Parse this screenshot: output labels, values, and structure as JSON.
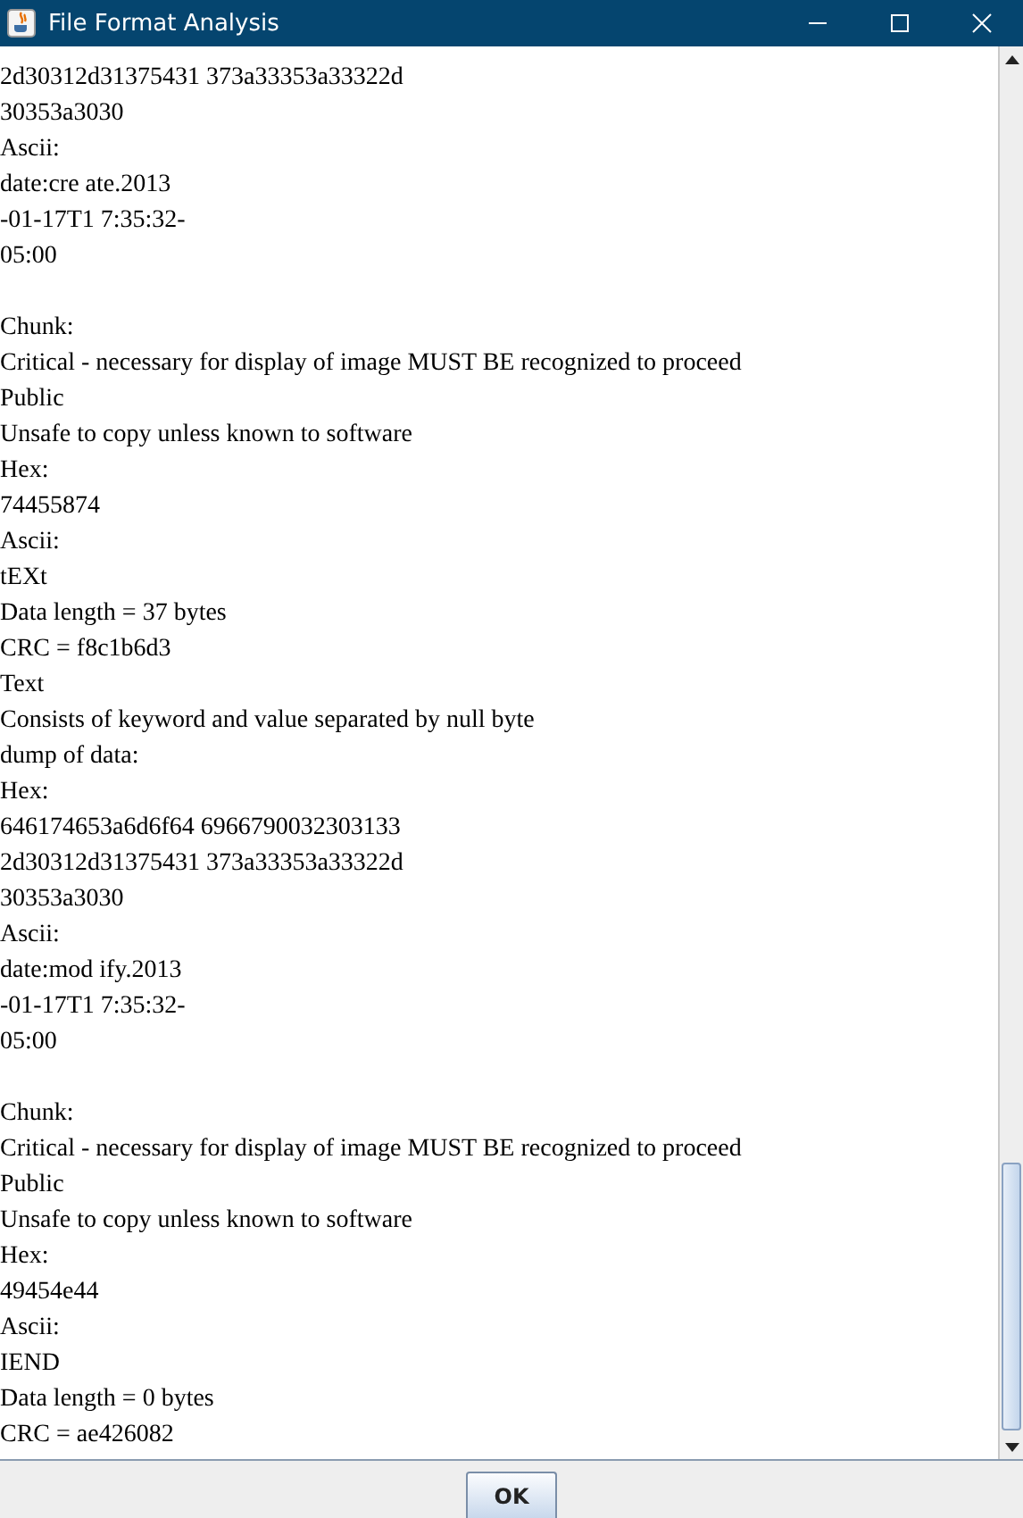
{
  "window": {
    "title": "File Format Analysis"
  },
  "blocks": [
    {
      "lines": [
        "2d30312d31375431 373a33353a33322d",
        "30353a3030",
        "Ascii:",
        "date:cre ate.2013",
        "-01-17T1 7:35:32-",
        "05:00"
      ]
    },
    {
      "lines": [
        "Chunk:",
        "Critical - necessary for display of image MUST BE recognized to proceed",
        "Public",
        "Unsafe to copy unless known to software",
        "Hex:",
        "74455874",
        "Ascii:",
        "tEXt",
        "Data length = 37 bytes",
        "CRC = f8c1b6d3",
        "Text",
        "Consists of keyword and value separated by null byte",
        "dump of data:",
        "Hex:",
        "646174653a6d6f64 6966790032303133",
        "2d30312d31375431 373a33353a33322d",
        "30353a3030",
        "Ascii:",
        "date:mod ify.2013",
        "-01-17T1 7:35:32-",
        "05:00"
      ]
    },
    {
      "lines": [
        "Chunk:",
        "Critical - necessary for display of image MUST BE recognized to proceed",
        "Public",
        "Unsafe to copy unless known to software",
        "Hex:",
        "49454e44",
        "Ascii:",
        "IEND",
        "Data length = 0 bytes",
        "CRC = ae426082"
      ]
    }
  ],
  "buttons": [
    "OK"
  ]
}
